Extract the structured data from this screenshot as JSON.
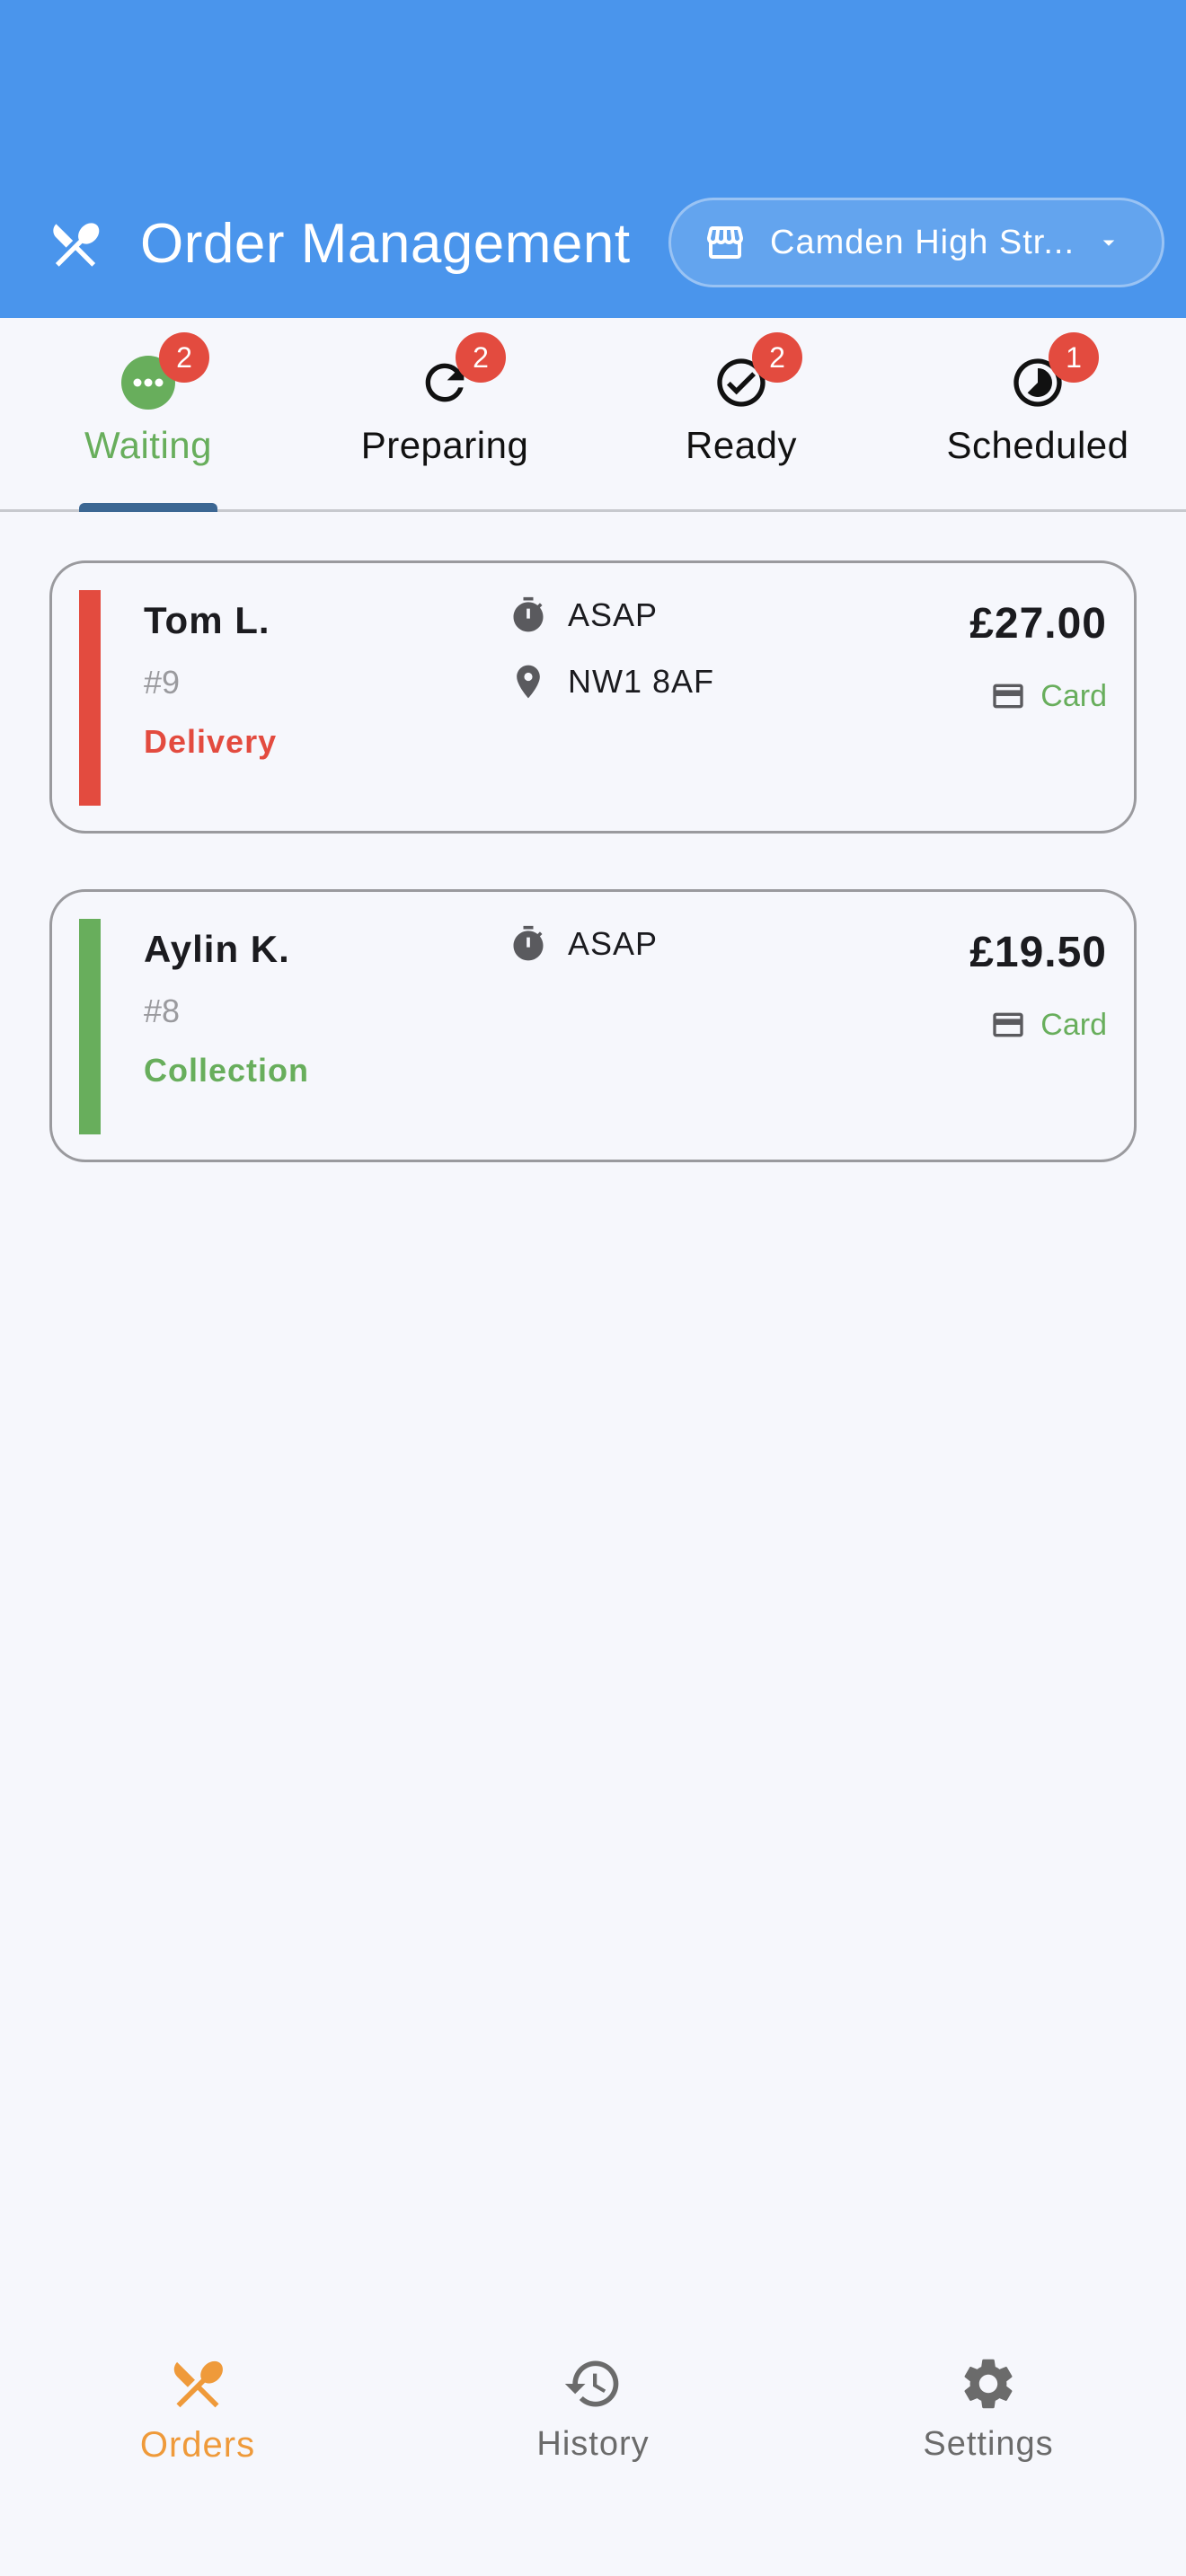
{
  "colors": {
    "primary": "#4a95ec",
    "waiting_green": "#68ae5c",
    "badge_red": "#e34b3f",
    "delivery_red": "#e34b3f",
    "collection_green": "#68ae5c",
    "active_nav_orange": "#ef9a3a",
    "tab_indicator": "#3c6793"
  },
  "appbar": {
    "icon": "cutlery-icon",
    "title": "Order Management",
    "store_select": {
      "icon": "store-icon",
      "value": "Camden High Str...",
      "caret": "caret-down-icon"
    }
  },
  "tabs": [
    {
      "label": "Waiting",
      "badge": "2",
      "icon": "more-horiz-circle-icon",
      "active": true
    },
    {
      "label": "Preparing",
      "badge": "2",
      "icon": "refresh-icon",
      "active": false
    },
    {
      "label": "Ready",
      "badge": "2",
      "icon": "check-circle-icon",
      "active": false
    },
    {
      "label": "Scheduled",
      "badge": "1",
      "icon": "timelapse-icon",
      "active": false
    }
  ],
  "orders": [
    {
      "customer": "Tom L.",
      "number": "#9",
      "type": "Delivery",
      "type_color": "#e34b3f",
      "time": "ASAP",
      "postcode": "NW1 8AF",
      "price": "£27.00",
      "payment": "Card"
    },
    {
      "customer": "Aylin K.",
      "number": "#8",
      "type": "Collection",
      "type_color": "#68ae5c",
      "time": "ASAP",
      "postcode": "",
      "price": "£19.50",
      "payment": "Card"
    }
  ],
  "bottom_nav": [
    {
      "label": "Orders",
      "icon": "cutlery-icon",
      "active": true
    },
    {
      "label": "History",
      "icon": "history-icon",
      "active": false
    },
    {
      "label": "Settings",
      "icon": "gear-icon",
      "active": false
    }
  ]
}
